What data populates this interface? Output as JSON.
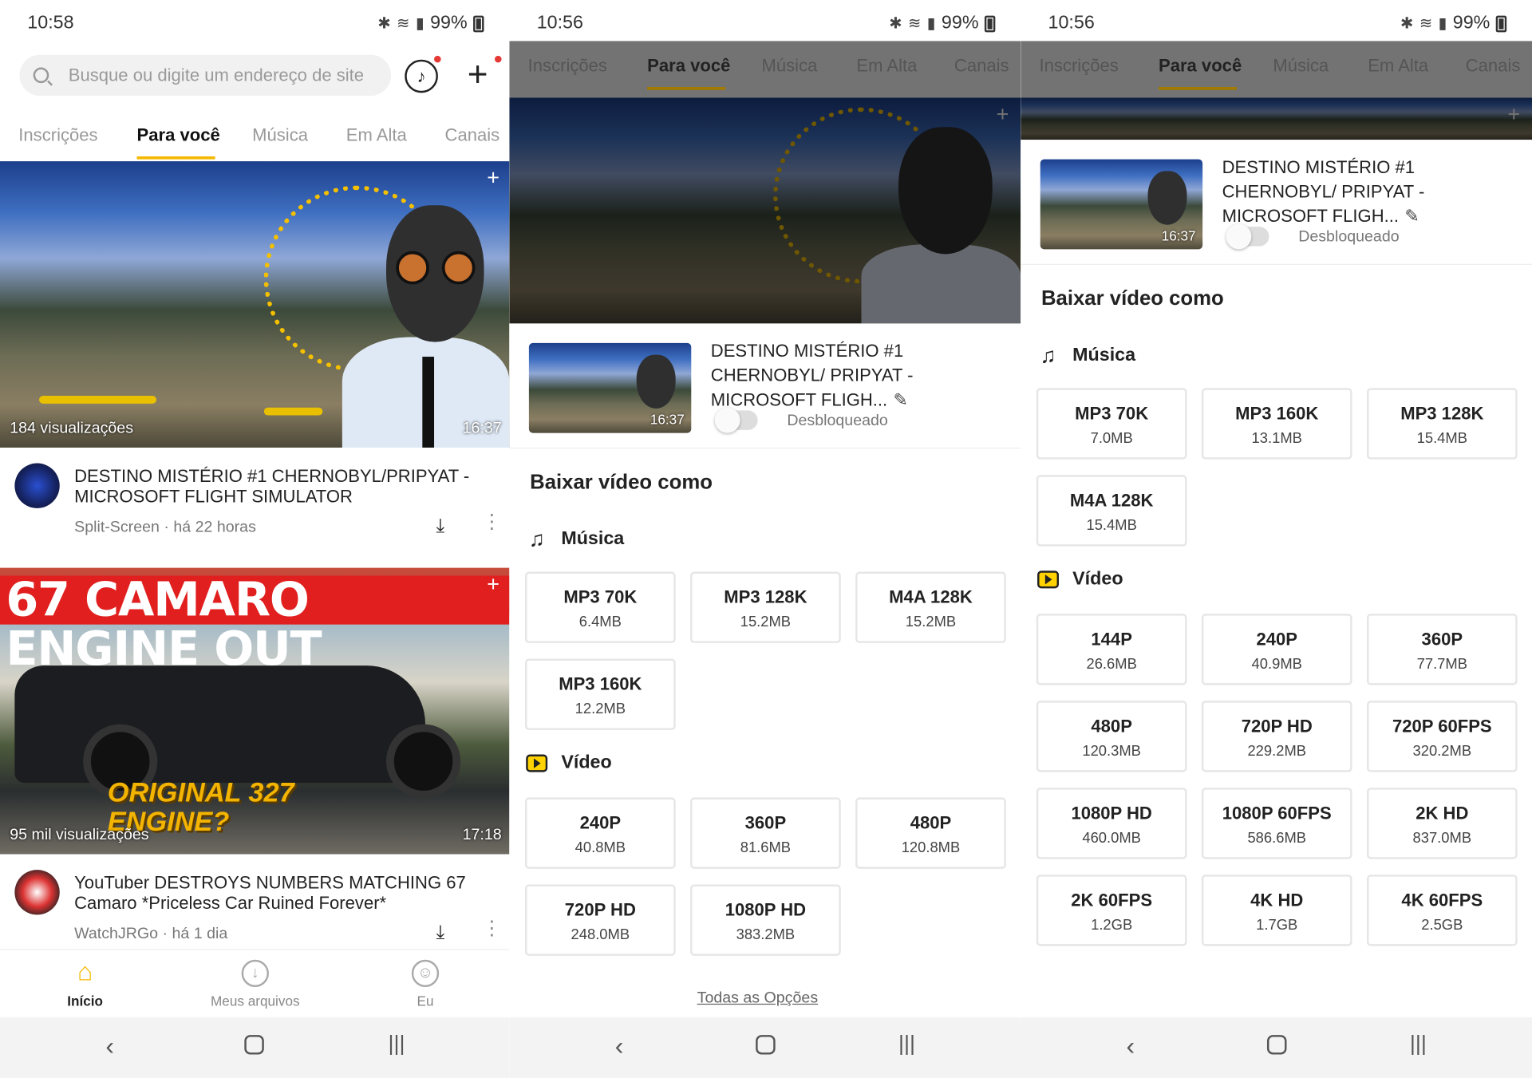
{
  "status": {
    "time1": "10:58",
    "time2": "10:56",
    "time3": "10:56",
    "battery": "99%"
  },
  "search": {
    "placeholder": "Busque ou digite um endereço de site"
  },
  "tabs": [
    "Inscrições",
    "Para você",
    "Música",
    "Em Alta",
    "Canais"
  ],
  "feed": [
    {
      "views": "184 visualizações",
      "duration": "16:37",
      "title": "DESTINO MISTÉRIO #1 CHERNOBYL/PRIPYAT - MICROSOFT FLIGHT SIMULATOR",
      "meta": "Split-Screen · há 22 horas"
    },
    {
      "banner": "67 CAMARO ENGINE OUT",
      "overlay_text": "ORIGINAL 327 ENGINE?",
      "views": "95 mil visualizações",
      "duration": "17:18",
      "title": "YouTuber DESTROYS NUMBERS MATCHING 67 Camaro *Priceless Car Ruined Forever*",
      "meta": "WatchJRGo · há 1 dia"
    }
  ],
  "bottom_nav": [
    "Início",
    "Meus arquivos",
    "Eu"
  ],
  "sheet": {
    "title": "DESTINO MISTÉRIO #1 CHERNOBYL/ PRIPYAT - MICROSOFT FLIGH...",
    "duration": "16:37",
    "unlocked": "Desbloqueado",
    "heading": "Baixar vídeo como",
    "music_label": "Música",
    "video_label": "Vídeo",
    "all_options": "Todas as Opções"
  },
  "panel2": {
    "music": [
      {
        "q": "MP3 70K",
        "s": "6.4MB"
      },
      {
        "q": "MP3 128K",
        "s": "15.2MB"
      },
      {
        "q": "M4A 128K",
        "s": "15.2MB"
      },
      {
        "q": "MP3 160K",
        "s": "12.2MB"
      }
    ],
    "video": [
      {
        "q": "240P",
        "s": "40.8MB"
      },
      {
        "q": "360P",
        "s": "81.6MB"
      },
      {
        "q": "480P",
        "s": "120.8MB"
      },
      {
        "q": "720P HD",
        "s": "248.0MB"
      },
      {
        "q": "1080P HD",
        "s": "383.2MB"
      }
    ]
  },
  "panel3": {
    "music": [
      {
        "q": "MP3 70K",
        "s": "7.0MB"
      },
      {
        "q": "MP3 160K",
        "s": "13.1MB"
      },
      {
        "q": "MP3 128K",
        "s": "15.4MB"
      },
      {
        "q": "M4A 128K",
        "s": "15.4MB"
      }
    ],
    "video": [
      {
        "q": "144P",
        "s": "26.6MB"
      },
      {
        "q": "240P",
        "s": "40.9MB"
      },
      {
        "q": "360P",
        "s": "77.7MB"
      },
      {
        "q": "480P",
        "s": "120.3MB"
      },
      {
        "q": "720P HD",
        "s": "229.2MB"
      },
      {
        "q": "720P 60FPS",
        "s": "320.2MB"
      },
      {
        "q": "1080P HD",
        "s": "460.0MB"
      },
      {
        "q": "1080P 60FPS",
        "s": "586.6MB"
      },
      {
        "q": "2K HD",
        "s": "837.0MB"
      },
      {
        "q": "2K 60FPS",
        "s": "1.2GB"
      },
      {
        "q": "4K HD",
        "s": "1.7GB"
      },
      {
        "q": "4K 60FPS",
        "s": "2.5GB"
      }
    ]
  },
  "colors": {
    "accent": "#f5b800",
    "dot": "#e53935",
    "overlay": "#000000"
  }
}
